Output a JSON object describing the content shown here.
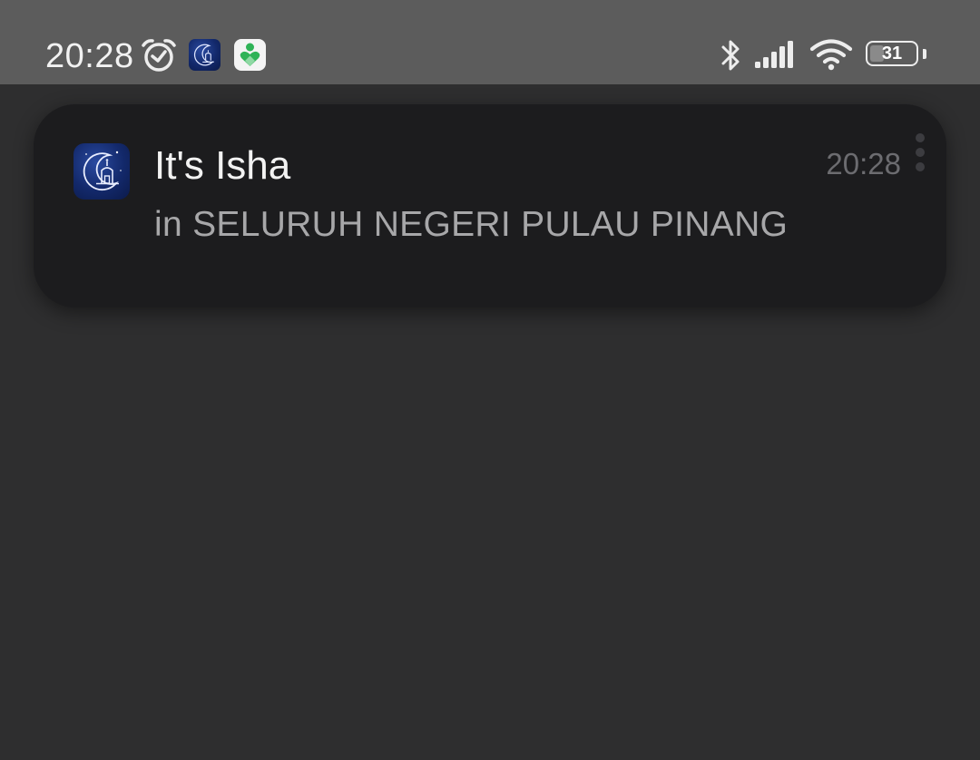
{
  "status_bar": {
    "time": "20:28",
    "battery_level": "31",
    "battery_fraction": 0.31,
    "icons": [
      "alarm-icon",
      "prayer-app-icon",
      "health-app-icon",
      "bluetooth-icon",
      "cellular-signal-icon",
      "wifi-icon",
      "battery-icon"
    ]
  },
  "notification": {
    "title": "It's Isha",
    "body": "in SELURUH NEGERI PULAU PINANG",
    "time": "20:28",
    "app_icon": "crescent-mosque-icon",
    "menu_icon": "more-vertical-icon"
  },
  "colors": {
    "status_bar_bg": "#5c5c5c",
    "screen_bg": "#2e2e2f",
    "card_bg": "#1c1c1e",
    "title_text": "#f2f2f2",
    "body_text": "#a7a7a9",
    "time_text": "#6c6c70"
  }
}
